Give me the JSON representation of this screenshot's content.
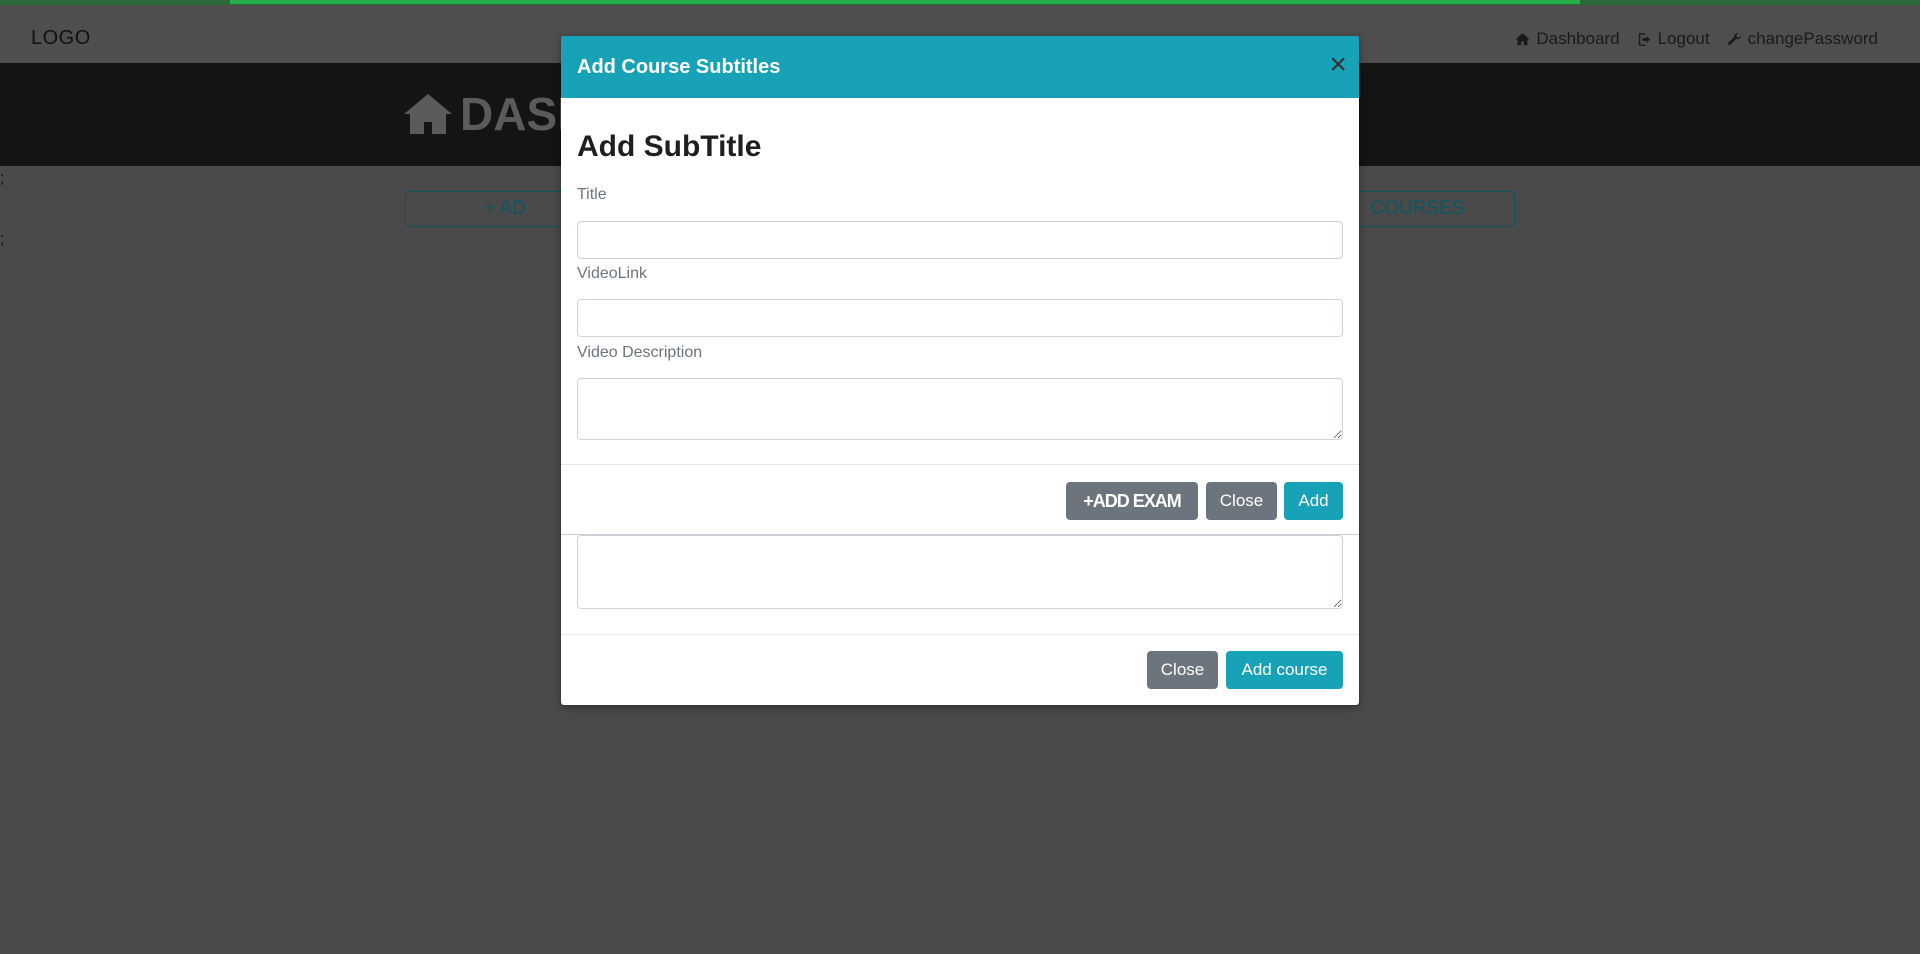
{
  "navbar": {
    "logo": "LOGO",
    "links": [
      {
        "label": "Dashboard",
        "icon": "home-icon"
      },
      {
        "label": "Logout",
        "icon": "logout-icon"
      },
      {
        "label": "changePassword",
        "icon": "wrench-icon"
      }
    ]
  },
  "hero": {
    "title": "DASH"
  },
  "background": {
    "semicolon_1": ";",
    "semicolon_2": ";",
    "add_button_label": "+ AD",
    "courses_button_label": "COURSES"
  },
  "modal": {
    "title": "Add Course Subtitles",
    "close_symbol": "×",
    "heading": "Add SubTitle",
    "fields": {
      "title_label": "Title",
      "title_value": "",
      "videolink_label": "VideoLink",
      "videolink_value": "",
      "description_label": "Video Description",
      "description_value": ""
    },
    "footer": {
      "add_exam_label": "+ADD EXAM",
      "close_label": "Close",
      "add_label": "Add"
    }
  },
  "underlying_modal": {
    "close_label": "Close",
    "add_course_label": "Add course"
  },
  "colors": {
    "accent": "#17a2b8",
    "secondary": "#6c757d",
    "backdrop": "#4a4a4a",
    "progress": "#27b04a"
  }
}
